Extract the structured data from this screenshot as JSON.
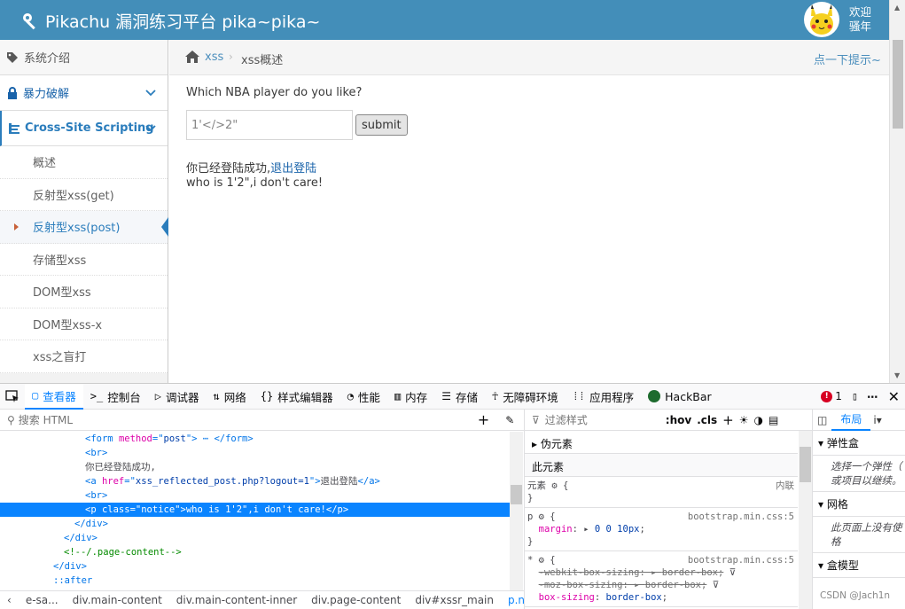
{
  "header": {
    "title": "Pikachu 漏洞练习平台 pika~pika~",
    "welcome_line1": "欢迎",
    "welcome_line2": "骚年"
  },
  "sidebar": {
    "top_item": "系统介绍",
    "items": [
      {
        "label": "暴力破解"
      },
      {
        "label": "Cross-Site Scripting"
      }
    ],
    "sub_items": [
      "概述",
      "反射型xss(get)",
      "反射型xss(post)",
      "存储型xss",
      "DOM型xss",
      "DOM型xss-x",
      "xss之盲打"
    ]
  },
  "breadcrumb": {
    "parent": "xss",
    "sep": "›",
    "current": "xss概述",
    "hint": "点一下提示~"
  },
  "main": {
    "question": "Which NBA player do you like?",
    "input_value": "1'</>2\"",
    "submit_label": "submit",
    "login_msg": "你已经登陆成功,",
    "logout_link": "退出登陆",
    "result": "who is 1'2\",i don't care!"
  },
  "devtools": {
    "tabs": [
      "查看器",
      "控制台",
      "调试器",
      "网络",
      "样式编辑器",
      "性能",
      "内存",
      "存储",
      "无障碍环境",
      "应用程序",
      "HackBar"
    ],
    "error_count": "1",
    "search_placeholder": "搜索 HTML",
    "tree": [
      {
        "indent": 8,
        "parts": [
          [
            "tg",
            "<form "
          ],
          [
            "an",
            "method"
          ],
          [
            "tg",
            "=\""
          ],
          [
            "av",
            "post"
          ],
          [
            "tg",
            "\">"
          ],
          [
            "",
            ""
          ],
          [
            "tg",
            " ⋯ </form>"
          ]
        ]
      },
      {
        "indent": 8,
        "parts": [
          [
            "tg",
            "<br>"
          ]
        ]
      },
      {
        "indent": 8,
        "parts": [
          [
            "",
            "你已经登陆成功,"
          ]
        ]
      },
      {
        "indent": 8,
        "parts": [
          [
            "tg",
            "<a "
          ],
          [
            "an",
            "href"
          ],
          [
            "tg",
            "=\""
          ],
          [
            "av",
            "xss_reflected_post.php?logout=1"
          ],
          [
            "tg",
            "\">"
          ],
          [
            "",
            "退出登陆"
          ],
          [
            "tg",
            "</a>"
          ]
        ]
      },
      {
        "indent": 8,
        "parts": [
          [
            "tg",
            "<br>"
          ]
        ]
      },
      {
        "indent": 8,
        "sel": true,
        "parts": [
          [
            "tg",
            "<p "
          ],
          [
            "an",
            "class"
          ],
          [
            "tg",
            "=\""
          ],
          [
            "av",
            "notice"
          ],
          [
            "tg",
            "\">"
          ],
          [
            "",
            "who is 1'2\",i don't care!"
          ],
          [
            "tg",
            "</p>"
          ]
        ]
      },
      {
        "indent": 7,
        "parts": [
          [
            "tg",
            "</div>"
          ]
        ]
      },
      {
        "indent": 6,
        "parts": [
          [
            "tg",
            "</div>"
          ]
        ]
      },
      {
        "indent": 6,
        "parts": [
          [
            "cm",
            "<!--/.page-content-->"
          ]
        ]
      },
      {
        "indent": 5,
        "parts": [
          [
            "tg",
            "</div>"
          ]
        ]
      },
      {
        "indent": 5,
        "parts": [
          [
            "tg",
            "::after"
          ]
        ]
      }
    ],
    "crumbs": [
      "e-sa...",
      "div.main-content",
      "div.main-content-inner",
      "div.page-content",
      "div#xssr_main",
      "p.notice"
    ],
    "rules": {
      "filter_placeholder": "过滤样式",
      "hov": ":hov",
      "cls": ".cls",
      "pseudo": "伪元素",
      "this_element": "此元素",
      "element_label": "元素",
      "inline": "内联",
      "src1": "bootstrap.min.css:5",
      "src2": "bootstrap.min.css:5",
      "margin_prop": "margin",
      "margin_val": "0 0 10px",
      "p1": "-webkit-box-sizing",
      "v1": "border-box",
      "p2": "-moz-box-sizing",
      "v2": "border-box",
      "p3": "box-sizing",
      "v3": "border-box"
    },
    "layout": {
      "tab": "布局",
      "flex": "弹性盒",
      "flex_note1": "选择一个弹性（",
      "flex_note2": "或项目以继续。",
      "grid": "网格",
      "grid_note1": "此页面上没有使",
      "grid_note2": "格",
      "box": "盒模型"
    }
  },
  "watermark": "CSDN @Jach1n",
  "colors": {
    "brand": "#438eb9",
    "accent": "#0a84ff",
    "link": "#1963aa"
  }
}
